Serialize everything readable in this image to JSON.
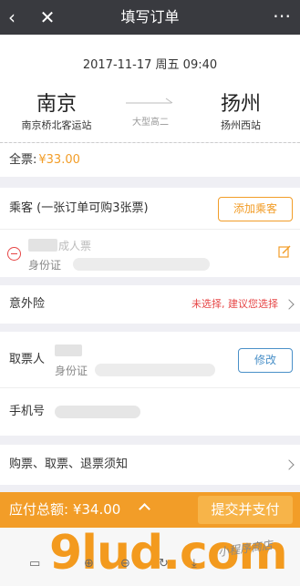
{
  "topbar": {
    "title": "填写订单",
    "back_glyph": "‹",
    "close_glyph": "✕",
    "more_glyph": "⋯"
  },
  "trip": {
    "datetime": "2017-11-17 周五 09:40",
    "from_city": "南京",
    "from_station": "南京桥北客运站",
    "to_city": "扬州",
    "to_station": "扬州西站",
    "bus_type": "大型高二"
  },
  "fare": {
    "label": "全票:",
    "price": "¥33.00"
  },
  "passengers": {
    "label": "乘客 (一张订单可购3张票)",
    "add_button": "添加乘客",
    "items": [
      {
        "ticket_type": "成人票",
        "id_label": "身份证"
      }
    ]
  },
  "insurance": {
    "label": "意外险",
    "hint": "未选择, 建议您选择"
  },
  "collector": {
    "label": "取票人",
    "id_label": "身份证",
    "modify_button": "修改"
  },
  "phone": {
    "label": "手机号"
  },
  "notice": {
    "label": "购票、取票、退票须知"
  },
  "bottombar": {
    "total": "应付总额: ¥34.00",
    "submit_button": "提交并支付"
  },
  "footer": {
    "watermark": "9lud.com",
    "watermark_sub": "小程序商店"
  },
  "colors": {
    "accent": "#f29d28",
    "danger": "#e64545",
    "link": "#4a90c8",
    "header": "#393a3f"
  }
}
